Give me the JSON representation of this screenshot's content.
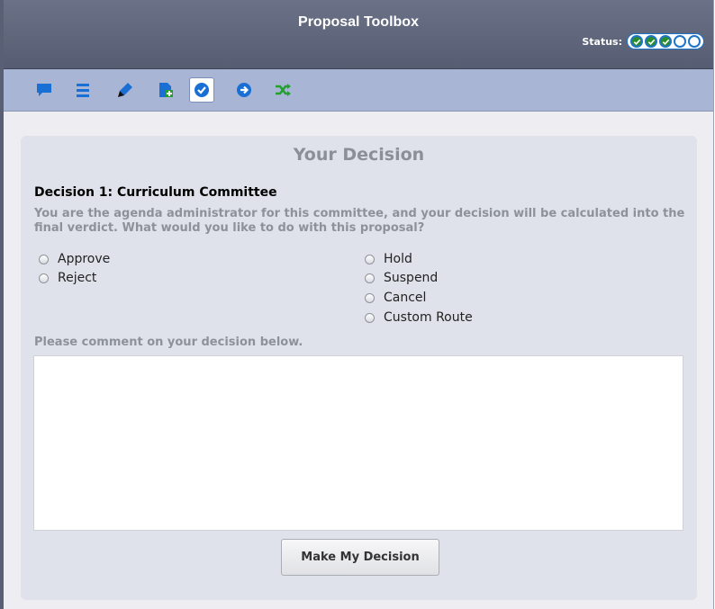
{
  "window": {
    "title": "Proposal Toolbox"
  },
  "status": {
    "label": "Status:",
    "steps": [
      true,
      true,
      true,
      false,
      false
    ]
  },
  "toolbar": [
    {
      "name": "comment-icon",
      "color": "#1a6fd4"
    },
    {
      "name": "list-icon",
      "color": "#1a6fd4"
    },
    {
      "name": "pen-icon",
      "color": "#1a6fd4"
    },
    {
      "name": "add-document-icon",
      "color": "#1a6fd4"
    },
    {
      "name": "checkmark-icon",
      "color": "#1a6fd4"
    },
    {
      "name": "arrow-right-circle-icon",
      "color": "#1a6fd4"
    },
    {
      "name": "shuffle-icon",
      "color": "#22a030"
    }
  ],
  "panel": {
    "heading": "Your Decision",
    "decision_title": "Decision 1: Curriculum Committee",
    "description": "You are the agenda administrator for this committee, and your decision will be calculated into the final verdict. What would you like to do with this proposal?",
    "options_left": [
      "Approve",
      "Reject"
    ],
    "options_right": [
      "Hold",
      "Suspend",
      "Cancel",
      "Custom Route"
    ],
    "comment_label": "Please comment on your decision below.",
    "comment_value": "",
    "submit_label": "Make My Decision"
  }
}
